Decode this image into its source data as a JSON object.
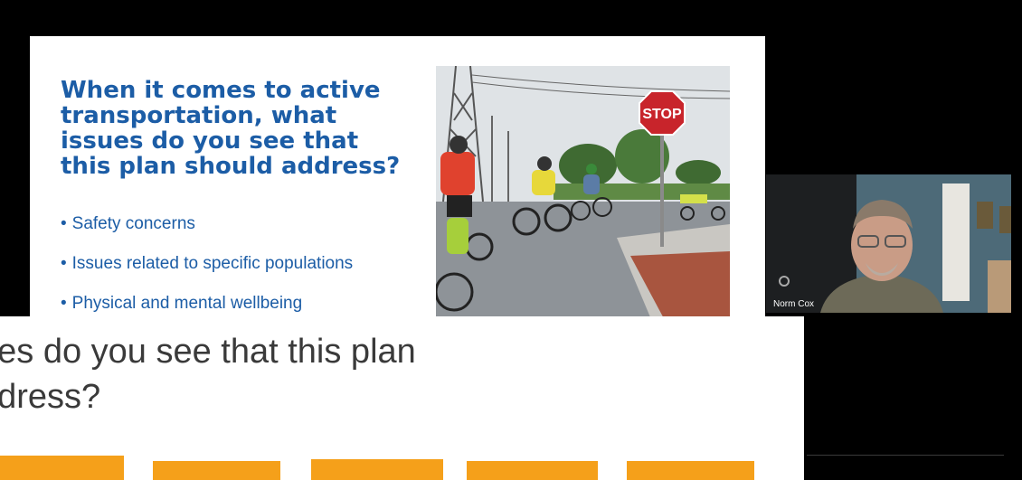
{
  "slide": {
    "title": "When it comes to active\ntransportation, what\nissues do you see that\nthis plan should address?",
    "bullets": [
      "Safety concerns",
      "Issues related to specific populations",
      "Physical and mental wellbeing"
    ],
    "photo": {
      "sign_text": "STOP"
    }
  },
  "video": {
    "participant_name": "Norm Cox"
  },
  "poll": {
    "question": "ues do you see that this plan\nddress?",
    "bar_color": "#f5a01a"
  },
  "colors": {
    "slide_title": "#1c5da6",
    "background": "#000000",
    "poll_bar": "#f5a01a"
  }
}
